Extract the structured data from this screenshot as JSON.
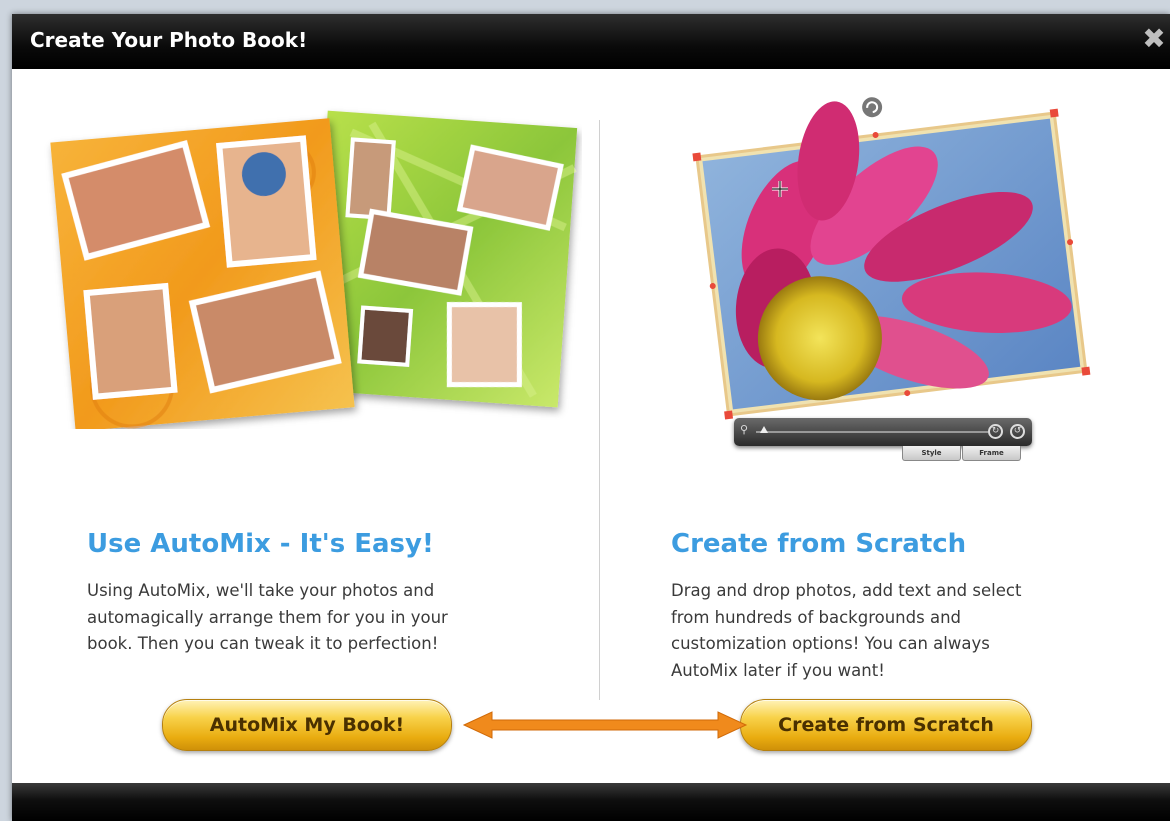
{
  "window": {
    "title": "Create Your Photo Book!",
    "close_glyph": "✖"
  },
  "automix": {
    "heading": "Use AutoMix - It's Easy!",
    "lines": [
      "Using AutoMix, we'll take your photos and",
      "automagically arrange them for you in your",
      "book. Then you can tweak it to perfection!"
    ],
    "button_label": "AutoMix My Book!"
  },
  "scratch": {
    "heading": "Create from Scratch",
    "lines": [
      "Drag and drop photos, add text and select",
      "from hundreds of backgrounds and",
      "customization options! You can always",
      "AutoMix later if you want!"
    ],
    "button_label": "Create from Scratch"
  },
  "editor_toolbar": {
    "style_tab": "Style",
    "frame_tab": "Frame"
  },
  "colors": {
    "heading": "#3c9ce0",
    "button_gold": "#f2c12e",
    "arrow_orange": "#f08a1c"
  },
  "icons": [
    "close-icon",
    "rotate-handle-icon",
    "move-cursor-icon",
    "zoom-icon",
    "rotate-right-icon",
    "rotate-left-icon",
    "double-arrow-icon"
  ]
}
